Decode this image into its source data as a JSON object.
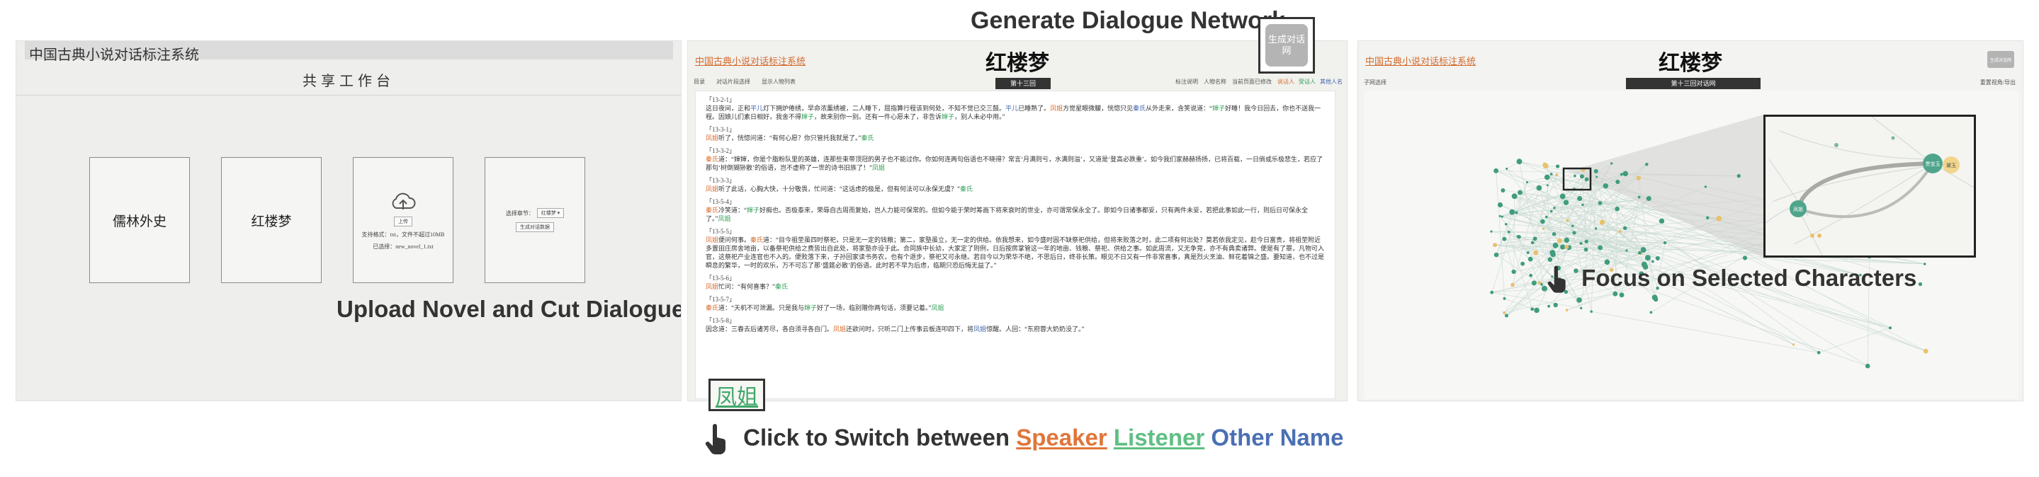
{
  "annotations": {
    "generate": "Generate Dialogue Network",
    "upload": "Upload Novel and Cut Dialogues",
    "click_prefix": "Click to Switch between",
    "speaker": "Speaker",
    "listener": "Listener",
    "other": "Other Name",
    "focus": "Focus on Selected Characters"
  },
  "colors": {
    "speaker": "#d66a2a",
    "listener": "#2e9f55",
    "other": "#3d63b0"
  },
  "panel1": {
    "app_title": "中国古典小说对话标注系统",
    "workspace": "共享工作台",
    "books": [
      "儒林外史",
      "红楼梦"
    ],
    "upload_card": {
      "icon": "cloud-upload-icon",
      "button": "上传",
      "note": "支持格式：txt，文件不超过10MB",
      "file": "已选择：new_novel_1.txt"
    },
    "cut_card": {
      "select_label": "选择章节：",
      "select_value": "红楼梦",
      "button": "生成对话数据"
    }
  },
  "panel2": {
    "brand": "中国古典小说对话标注系统",
    "book": "红楼梦",
    "toolbar_left": [
      "目录",
      "对话片段选择",
      "显示人物列表"
    ],
    "chapter_tab": "第十三回",
    "toolbar_right": [
      "标注说明",
      "人物名称",
      "当前页面已修改",
      "说话人",
      "受话人",
      "其他人名"
    ],
    "generate_button": "生成对话网",
    "zoom_name": "凤姐",
    "dialogues": [
      {
        "id": "「13-2-1」",
        "segments": [
          [
            "t",
            "这日夜间，正和"
          ],
          [
            "o",
            "平儿"
          ],
          [
            "t",
            "灯下拥炉倦绣，早命浓薰绣被，二人睡下，屈指算行程该到何处，不知不觉已交三鼓。"
          ],
          [
            "o",
            "平儿"
          ],
          [
            "t",
            "已睡熟了。"
          ],
          [
            "s",
            "凤姐"
          ],
          [
            "t",
            "方觉星眼微朦，恍惚只见"
          ],
          [
            "o",
            "秦氏"
          ],
          [
            "t",
            "从外走来，含笑说道：“"
          ],
          [
            "l",
            "婶子"
          ],
          [
            "t",
            "好睡！我今日回去，你也不送我一程。因娘儿们素日相好，我舍不得"
          ],
          [
            "l",
            "婶子"
          ],
          [
            "t",
            "，故来别你一别。还有一件心愿未了，非告诉"
          ],
          [
            "l",
            "婶子"
          ],
          [
            "t",
            "，别人未必中用。”"
          ]
        ]
      },
      {
        "id": "「13-3-1」",
        "segments": [
          [
            "s",
            "凤姐"
          ],
          [
            "t",
            "听了，恍惚问道：“有何心愿？你只管托我就是了。”"
          ],
          [
            "l",
            "秦氏"
          ]
        ]
      },
      {
        "id": "「13-3-2」",
        "segments": [
          [
            "s",
            "秦氏"
          ],
          [
            "t",
            "道：“婶婶，你是个脂粉队里的英雄，连那些束带顶冠的男子也不能过你。你如何连两句俗语也不晓得？常言‘月满则亏，水满则溢’，又道是‘登高必跌重’。如今我们家赫赫扬扬，已将百载，一日倘或乐极悲生，若应了那句‘树倒猢狲散’的俗语，岂不虚称了一世的诗书旧族了！”"
          ],
          [
            "l",
            "凤姐"
          ]
        ]
      },
      {
        "id": "「13-3-3」",
        "segments": [
          [
            "s",
            "凤姐"
          ],
          [
            "t",
            "听了此话，心胸大快，十分敬畏，忙问道：“这话虑的极是，但有何法可以永保无虞？”"
          ],
          [
            "l",
            "秦氏"
          ]
        ]
      },
      {
        "id": "「13-5-4」",
        "segments": [
          [
            "s",
            "秦氏"
          ],
          [
            "t",
            "冷笑道：“"
          ],
          [
            "l",
            "婶子"
          ],
          [
            "t",
            "好痴也。否极泰来，荣辱自古周而复始，岂人力能可保常的。但如今能于荣时筹画下将来衰时的世业，亦可谓常保永全了。即如今日诸事都妥，只有两件未妥，若把此事如此一行，则后日可保永全了。”"
          ],
          [
            "l",
            "凤姐"
          ]
        ]
      },
      {
        "id": "「13-5-5」",
        "segments": [
          [
            "s",
            "凤姐"
          ],
          [
            "t",
            "便问何事。"
          ],
          [
            "s",
            "秦氏"
          ],
          [
            "t",
            "道：“目今祖茔虽四时祭祀，只是无一定的钱粮；第二，家塾虽立，无一定的供给。依我想来，如今盛时固不缺祭祀供给，但将来败落之时，此二项有何出处？莫若依我定见，趁今日富贵，将祖茔附近多置田庄房舍地亩，以备祭祀供给之费皆出自此处，将家塾亦设于此。合同族中长幼，大家定了则例，日后按房掌管这一年的地亩、钱粮、祭祀、供给之事。如此周流，又无争竞，亦不有典卖诸弊。便是有了罪，凡物可入官，这祭祀产业连官也不入的。便败落下来，子孙回家读书务农，也有个退步，祭祀又可永继。若目今以为荣华不绝，不思后日，终非长策。眼见不日又有一件非常喜事，真是烈火烹油、鲜花着锦之盛。要知道，也不过是瞬息的繁华，一时的欢乐，万不可忘了那‘盛筵必散’的俗语。此时若不早为后虑，临期只恐后悔无益了。”"
          ]
        ]
      },
      {
        "id": "「13-5-6」",
        "segments": [
          [
            "s",
            "凤姐"
          ],
          [
            "t",
            "忙问：“有何喜事？”"
          ],
          [
            "l",
            "秦氏"
          ]
        ]
      },
      {
        "id": "「13-5-7」",
        "segments": [
          [
            "s",
            "秦氏"
          ],
          [
            "t",
            "道：“天机不可泄漏。只是我与"
          ],
          [
            "l",
            "婶子"
          ],
          [
            "t",
            "好了一场，临别赠你两句话，须要记着。”"
          ],
          [
            "l",
            "凤姐"
          ]
        ]
      },
      {
        "id": "「13-5-8」",
        "segments": [
          [
            "t",
            "因念道：三春去后诸芳尽，各自须寻各自门。"
          ],
          [
            "s",
            "凤姐"
          ],
          [
            "t",
            "还欲问时，只听二门上传事云板连叩四下，将"
          ],
          [
            "o",
            "凤姐"
          ],
          [
            "t",
            "惊醒。人回：“东府蓉大奶奶没了。”"
          ]
        ]
      }
    ]
  },
  "panel3": {
    "brand": "中国古典小说对话标注系统",
    "book": "红楼梦",
    "generate_button": "生成对话网",
    "left_tool": "子网选择",
    "tab": "第十三回对话网",
    "right_tool": "重置视角/导出",
    "zoom_nodes": [
      "贾宝玉",
      "黛玉",
      "凤姐"
    ]
  }
}
